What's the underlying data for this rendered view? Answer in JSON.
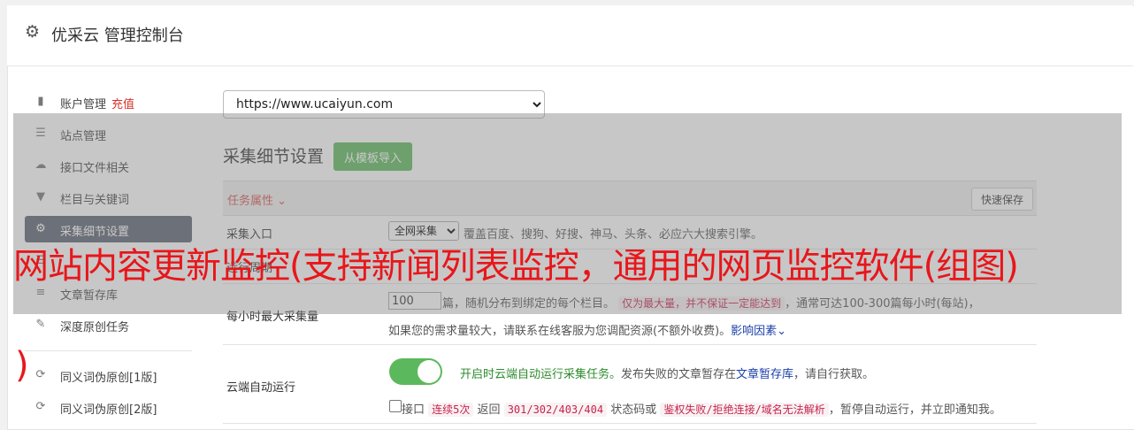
{
  "header": {
    "gear_icon": "gear-icon",
    "title": "优采云 管理控制台"
  },
  "sidebar": {
    "items": [
      {
        "icon": "bar-chart-icon",
        "glyph": "📊",
        "label": "账户管理",
        "extra": "充值"
      },
      {
        "icon": "server-icon",
        "glyph": "☰",
        "label": "站点管理"
      },
      {
        "icon": "cloud-upload-icon",
        "glyph": "☁",
        "label": "接口文件相关"
      },
      {
        "icon": "filter-icon",
        "glyph": "▼",
        "label": "栏目与关键词"
      },
      {
        "icon": "cogs-icon",
        "glyph": "⚙",
        "label": "采集细节设置"
      },
      {
        "icon": "list-icon",
        "glyph": "☰",
        "label": ""
      },
      {
        "icon": "database-icon",
        "glyph": "≡",
        "label": "文章暂存库"
      },
      {
        "icon": "edit-icon",
        "glyph": "✎",
        "label": "深度原创任务"
      },
      {
        "icon": "refresh-icon",
        "glyph": "⟳",
        "label": "同义词伪原创[1版]"
      },
      {
        "icon": "refresh-icon",
        "glyph": "⟳",
        "label": "同义词伪原创[2版]"
      }
    ]
  },
  "main": {
    "url_select": "https://www.ucaiyun.com",
    "section_title": "采集细节设置",
    "import_button": "从模板导入",
    "task_attr": "任务属性 ⌄",
    "quick_save": "快速保存",
    "row1": {
      "label": "采集入口",
      "select_value": "全网采集",
      "desc": "覆盖百度、搜狗、好搜、神马、头条、必应六大搜索引擎。"
    },
    "row2": {
      "label": "运行周期"
    },
    "row3": {
      "label": "每小时最大采集量",
      "value": "100",
      "t1": "篇，随机分布到绑定的每个栏目。",
      "code1": "仅为最大量，并不保证一定能达到",
      "t2": "，通常可达100-300篇每小时(每站)，",
      "t3": "如果您的需求量较大，请联系在线客服为您调配资源(不额外收费)。",
      "link": "影响因素"
    },
    "row4": {
      "label": "云端自动运行",
      "enable_text": "开启时云端自动运行采集任务。",
      "t1": "发布失败的文章暂存在",
      "link": "文章暂存库",
      "t2": "，请自行获取。",
      "cb_text": "接口",
      "code1": "连续5次",
      "t3": "返回",
      "code2": "301/302/403/404",
      "t4": "状态码或",
      "code3": "鉴权失败/拒绝连接/域名无法解析",
      "t5": "，暂停自动运行，并立即通知我。"
    }
  },
  "watermark": {
    "line1": "网站内容更新监控(支持新闻列表监控，通用的网页监控软件(组图)",
    "line2": ")"
  }
}
